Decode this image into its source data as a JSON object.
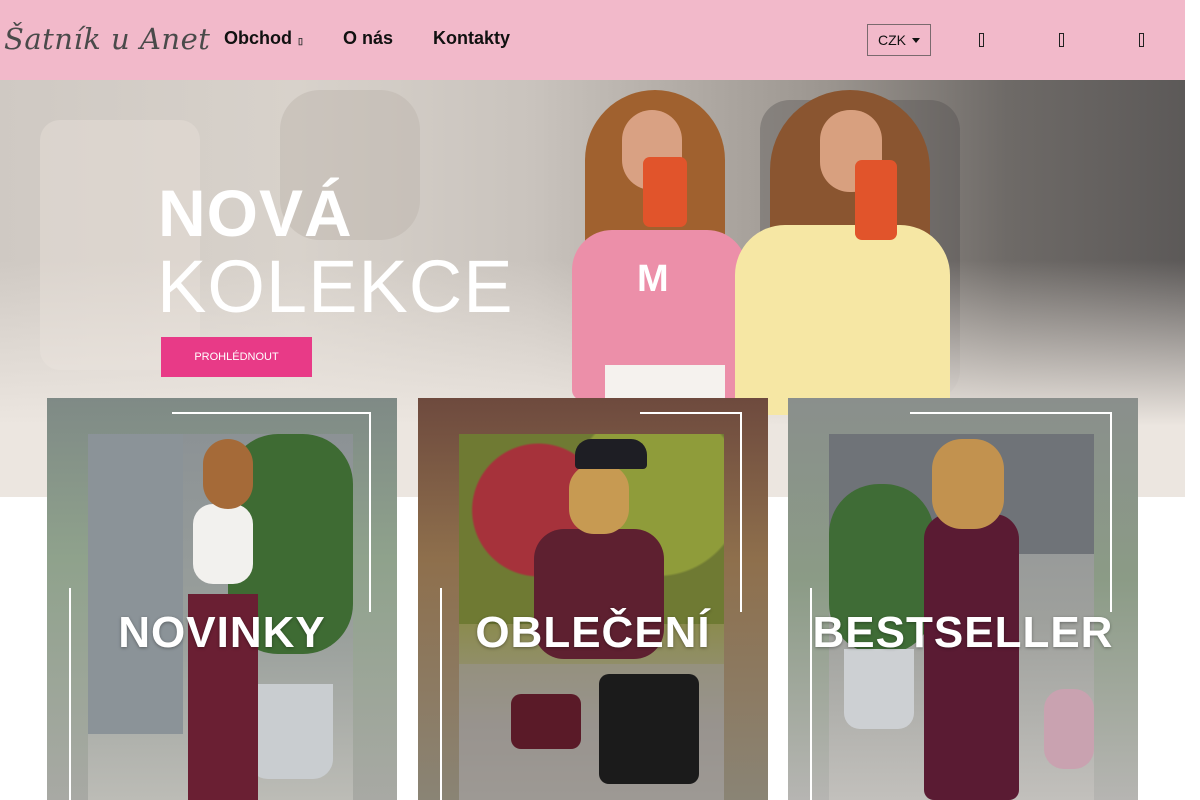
{
  "header": {
    "logo": "Šatník u Anet",
    "nav": [
      {
        "label": "Obchod",
        "has_dropdown": true
      },
      {
        "label": "O nás"
      },
      {
        "label": "Kontakty"
      }
    ],
    "currency": "CZK",
    "icons": [
      "user-icon",
      "heart-icon",
      "cart-icon"
    ]
  },
  "hero": {
    "title_line1": "NOVÁ",
    "title_line2": "KOLEKCE",
    "button_label": "PROHLÉDNOUT",
    "sweater_letter": "M"
  },
  "categories": [
    {
      "label": "NOVINKY"
    },
    {
      "label": "OBLEČENÍ"
    },
    {
      "label": "BESTSELLER"
    }
  ],
  "colors": {
    "header_bg": "#f2b9ca",
    "accent": "#e83a87"
  }
}
